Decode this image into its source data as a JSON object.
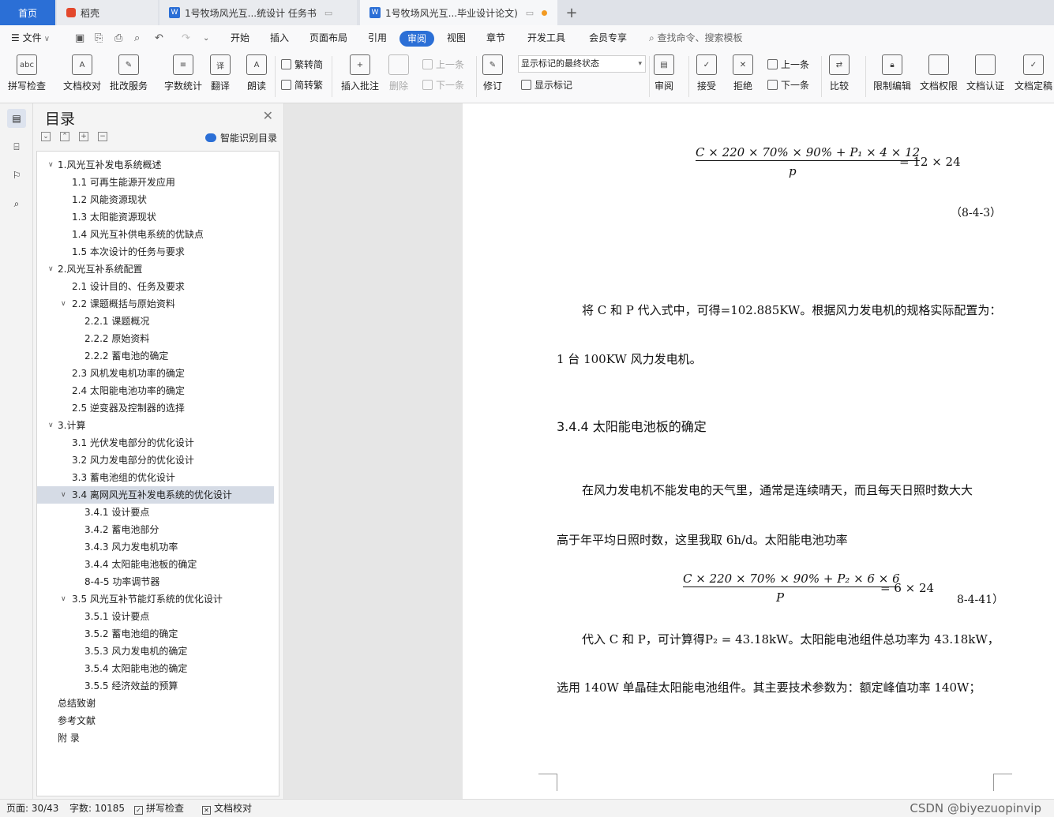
{
  "tabs": {
    "home": "首页",
    "daoke": "稻壳",
    "doc1": "1号牧场风光互...统设计 任务书",
    "doc2": "1号牧场风光互...毕业设计论文)",
    "doc_icon": "W"
  },
  "menu": {
    "file": "文件",
    "items": [
      "开始",
      "插入",
      "页面布局",
      "引用",
      "审阅",
      "视图",
      "章节",
      "开发工具",
      "会员专享"
    ],
    "active": "审阅",
    "search": "查找命令、搜索模板"
  },
  "ribbon": {
    "spell": "拼写检查",
    "doc_check": "文档校对",
    "annotate_service": "批改服务",
    "word_count": "字数统计",
    "translate": "翻译",
    "read_aloud": "朗读",
    "to_trad": "繁转简",
    "to_simp": "简转繁",
    "insert_comment": "插入批注",
    "delete": "删除",
    "prev": "上一条",
    "next": "下一条",
    "revise": "修订",
    "markup_state": "显示标记的最终状态",
    "show_markup": "显示标记",
    "review": "审阅",
    "accept": "接受",
    "reject": "拒绝",
    "prev2": "上一条",
    "next2": "下一条",
    "compare": "比较",
    "restrict_edit": "限制编辑",
    "doc_permission": "文档权限",
    "doc_auth": "文档认证",
    "doc_finalize": "文档定稿"
  },
  "toc": {
    "title": "目录",
    "smart": "智能识别目录",
    "items": [
      {
        "label": "1.风光互补发电系统概述",
        "level": 1,
        "expand": true
      },
      {
        "label": "1.1  可再生能源开发应用",
        "level": 2
      },
      {
        "label": "1.2  风能资源现状",
        "level": 2
      },
      {
        "label": "1.3  太阳能资源现状",
        "level": 2
      },
      {
        "label": "1.4  风光互补供电系统的优缺点",
        "level": 2
      },
      {
        "label": "1.5 本次设计的任务与要求",
        "level": 2
      },
      {
        "label": "2.风光互补系统配置",
        "level": 1,
        "expand": true
      },
      {
        "label": "2.1 设计目的、任务及要求",
        "level": 2
      },
      {
        "label": "2.2 课题概括与原始资料",
        "level": 2,
        "expand": true
      },
      {
        "label": "2.2.1 课题概况",
        "level": 3
      },
      {
        "label": "2.2.2 原始资料",
        "level": 3
      },
      {
        "label": "2.2.2 蓄电池的确定",
        "level": 3
      },
      {
        "label": "2.3 风机发电机功率的确定",
        "level": 2
      },
      {
        "label": "2.4 太阳能电池功率的确定",
        "level": 2
      },
      {
        "label": "2.5 逆变器及控制器的选择",
        "level": 2
      },
      {
        "label": "3.计算",
        "level": 1,
        "expand": true
      },
      {
        "label": "3.1 光伏发电部分的优化设计",
        "level": 2
      },
      {
        "label": "3.2 风力发电部分的优化设计",
        "level": 2
      },
      {
        "label": "3.3 蓄电池组的优化设计",
        "level": 2
      },
      {
        "label": "3.4  离网风光互补发电系统的优化设计",
        "level": 2,
        "expand": true,
        "selected": true
      },
      {
        "label": "3.4.1 设计要点",
        "level": 3
      },
      {
        "label": "3.4.2 蓄电池部分",
        "level": 3
      },
      {
        "label": "3.4.3 风力发电机功率",
        "level": 3
      },
      {
        "label": "3.4.4 太阳能电池板的确定",
        "level": 3
      },
      {
        "label": "8-4-5 功率调节器",
        "level": 3
      },
      {
        "label": "3.5  风光互补节能灯系统的优化设计",
        "level": 2,
        "expand": true
      },
      {
        "label": "3.5.1 设计要点",
        "level": 3
      },
      {
        "label": "3.5.2 蓄电池组的确定",
        "level": 3
      },
      {
        "label": "3.5.3 风力发电机的确定",
        "level": 3
      },
      {
        "label": "3.5.4 太阳能电池的确定",
        "level": 3
      },
      {
        "label": "3.5.5 经济效益的预算",
        "level": 3
      },
      {
        "label": "总结致谢",
        "level": 1
      },
      {
        "label": "参考文献",
        "level": 1
      },
      {
        "label": "附  录",
        "level": 1
      }
    ]
  },
  "doc": {
    "eq1_num": "C × 220 × 70% × 90% + P₁ × 4 × 12",
    "eq1_den": "p",
    "eq1_rhs": "= 12 × 24",
    "eq1_label": "（8-4-3）",
    "para1": "将 C 和 P 代入式中，可得=102.885KW。根据风力发电机的规格实际配置为：",
    "para2": "1 台 100KW 风力发电机。",
    "heading": "3.4.4 太阳能电池板的确定",
    "para3": "在风力发电机不能发电的天气里，通常是连续晴天，而且每天日照时数大大",
    "para4": "高于年平均日照时数，这里我取 6h/d。太阳能电池功率",
    "eq2_num": "C × 220 × 70% × 90% + P₂ × 6 × 6",
    "eq2_den": "P",
    "eq2_rhs": "= 6 × 24",
    "eq2_label": "8-4-41）",
    "para5": "代入 C 和 P，可计算得P₂ = 43.18kW。太阳能电池组件总功率为 43.18kW，",
    "para6": "选用 140W 单晶硅太阳能电池组件。其主要技术参数为：额定峰值功率 140W；"
  },
  "status": {
    "page": "页面: 30/43",
    "words": "字数: 10185",
    "spell": "拼写检查",
    "proof": "文档校对",
    "watermark": "CSDN @biyezuopinvip"
  },
  "colors": {
    "accent": "#2b6fd6",
    "selected_row": "#d5dbe5",
    "unsaved_dot": "#f29a22"
  }
}
